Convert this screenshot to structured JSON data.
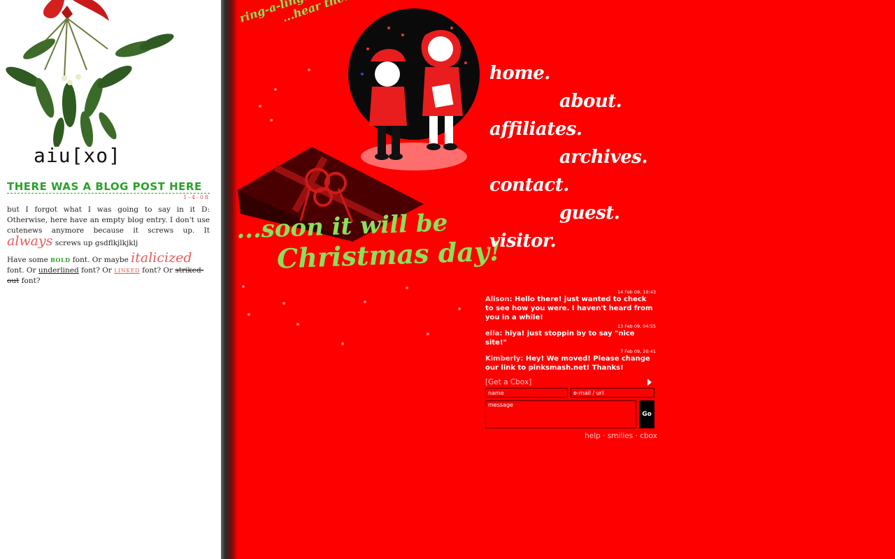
{
  "site": {
    "title": "aiu[xo]"
  },
  "post": {
    "title": "THERE WAS A BLOG POST HERE",
    "date": "1-4-08",
    "p1": "but I forgot what I was going to say in it D: Otherwise, here have an empty blog entry. I don't use cutenews anymore because it screws up. It ",
    "p1_fancy": "always",
    "p1_end": " screws up gsdflkjlkjklj",
    "p2_a": "Have some ",
    "p2_bold": "BOLD",
    "p2_b": " font. Or maybe ",
    "p2_italic": "italicized",
    "p2_c": " font. Or ",
    "p2_underline": "underlined",
    "p2_d": " font? Or ",
    "p2_linked": "LINKED",
    "p2_e": " font? Or ",
    "p2_strike": "striked-out",
    "p2_f": " font?"
  },
  "art": {
    "ring1": "ring-a-ling...",
    "ring2": "...hear them ring",
    "soon1": "...soon it will be",
    "soon2": "Christmas day!"
  },
  "nav": {
    "home": "home.",
    "about": "about.",
    "affiliates": "affiliates.",
    "archives": "archives.",
    "contact": "contact.",
    "guest": "guest.",
    "visitor": "visitor."
  },
  "cbox": {
    "messages": [
      {
        "time": "14 Feb 09, 10:43",
        "name": "Alison:",
        "text": " Hello there! just wanted to check to see how you were. I haven't heard from you in a while!"
      },
      {
        "time": "13 Feb 09, 04:55",
        "name": "ella:",
        "text": " hiya! just stoppin by to say \"nice site!\""
      },
      {
        "time": "7 Feb 09, 20:41",
        "name": "Kimberly:",
        "text": " Hey! We moved! Please change our link to pinksmash.net! Thanks!"
      }
    ],
    "get_link": "[Get a Cbox]",
    "name_placeholder": "name",
    "email_placeholder": "e-mail / url",
    "message_placeholder": "message",
    "go_label": "Go",
    "help": "help",
    "smilies": "smilies",
    "cbox": "cbox",
    "sep": " · "
  }
}
